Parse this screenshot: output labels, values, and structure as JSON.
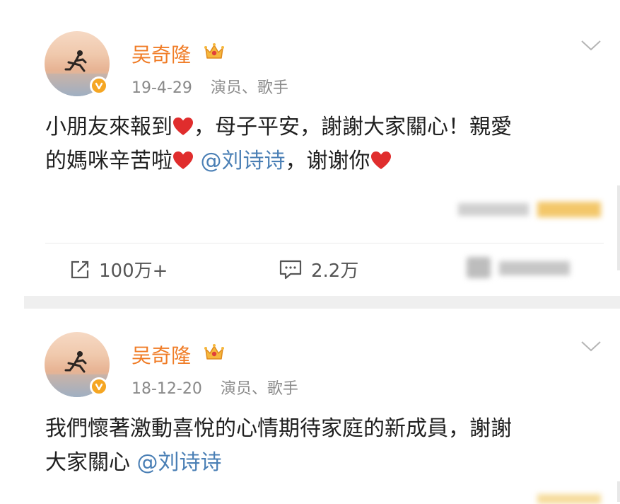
{
  "posts": [
    {
      "username": "吴奇隆",
      "date": "19-4-29",
      "role": "演员、歌手",
      "content_line1_a": "小朋友來報到",
      "content_line1_b": "，母子平安，謝謝大家關心！親愛",
      "content_line2_a": "的媽咪辛苦啦",
      "mention": "@刘诗诗",
      "content_line2_b": "，谢谢你",
      "share_count": "100万+",
      "comment_count": "2.2万"
    },
    {
      "username": "吴奇隆",
      "date": "18-12-20",
      "role": "演员、歌手",
      "content_line1": "我們懷著激動喜悅的心情期待家庭的新成員，謝謝",
      "content_line2_a": "大家關心",
      "mention": "@刘诗诗"
    }
  ],
  "colors": {
    "username": "#f07c26",
    "mention": "#4a7fb5",
    "heart": "#e02d2d",
    "badge": "#f5a623"
  },
  "icons": [
    "crown-icon",
    "verified-badge-icon",
    "chevron-down-icon",
    "heart-icon",
    "share-icon",
    "comment-icon",
    "like-icon"
  ]
}
